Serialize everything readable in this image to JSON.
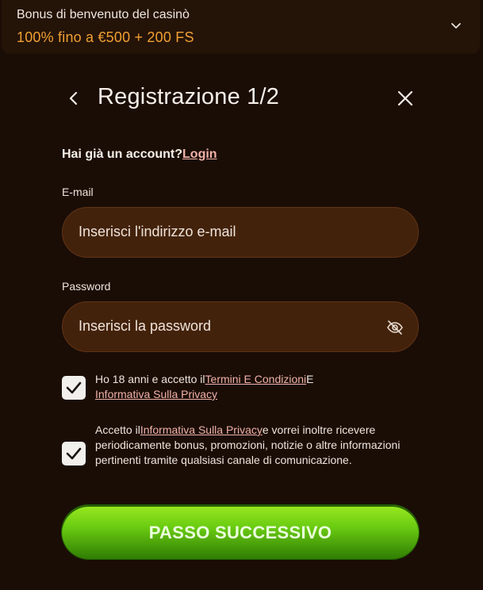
{
  "bonus": {
    "title": "Bonus di benvenuto del casinò",
    "offer": "100% fino a €500 + 200 FS",
    "chevron_icon": "chevron-down-icon"
  },
  "header": {
    "title": "Registrazione 1/2",
    "back_icon": "chevron-left-icon",
    "close_icon": "close-icon"
  },
  "login": {
    "prompt": "Hai già un account?",
    "link_label": "Login"
  },
  "email": {
    "label": "E-mail",
    "placeholder": "Inserisci l'indirizzo e-mail"
  },
  "password": {
    "label": "Password",
    "placeholder": "Inserisci la password",
    "toggle_icon": "eye-off-icon"
  },
  "consents": [
    {
      "checked": true,
      "text_before": "Ho 18 anni e accetto il",
      "link1": "Termini E Condizioni",
      "text_mid": "E",
      "link2": "Informativa Sulla Privacy",
      "text_after": ""
    },
    {
      "checked": true,
      "text_before": "Accetto il",
      "link1": "Informativa Sulla Privacy",
      "text_after": "e vorrei inoltre ricevere periodicamente bonus, promozioni, notizie o altre informazioni pertinenti tramite qualsiasi canale di comunicazione."
    }
  ],
  "next_button": {
    "label": "PASSO SUCCESSIVO"
  },
  "colors": {
    "background": "#1a0d06",
    "accent_orange": "#f0a033",
    "link_pink": "#f0b2a8",
    "input_bg": "#43220b",
    "button_green": "#6bcc12"
  }
}
